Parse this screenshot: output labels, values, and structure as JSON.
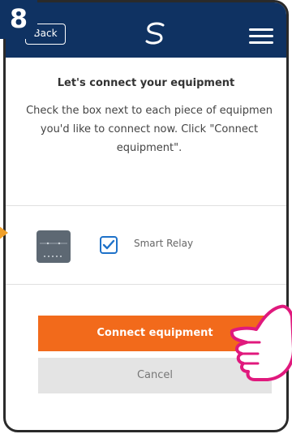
{
  "step": {
    "number": "8"
  },
  "header": {
    "back_label": "Back"
  },
  "content": {
    "title": "Let's connect your equipment",
    "instructions_line1": "Check the box next to each piece of equipmen",
    "instructions_line2": "you'd like to connect now. Click \"Connect",
    "instructions_line3": "equipment\"."
  },
  "equipment": {
    "items": [
      {
        "label": "Smart Relay",
        "checked": true,
        "icon": "smart-relay-device-icon"
      }
    ]
  },
  "actions": {
    "connect_label": "Connect equipment",
    "cancel_label": "Cancel"
  },
  "colors": {
    "header_bg": "#0f3262",
    "primary_button": "#f26a1b",
    "cancel_button": "#e4e4e4",
    "checkbox_accent": "#1f72c9",
    "annotation_pointer": "#e0197d"
  }
}
